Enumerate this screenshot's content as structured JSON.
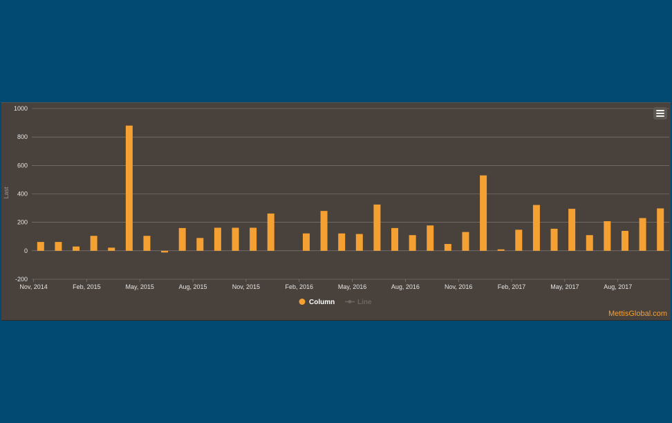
{
  "chart_data": {
    "type": "bar",
    "ylabel": "Last",
    "ylim": [
      -200,
      1000
    ],
    "yticks": [
      -200,
      0,
      200,
      400,
      600,
      800,
      1000
    ],
    "grid": true,
    "legend_position": "bottom-center",
    "x_tick_labels": [
      "Nov, 2014",
      "Feb, 2015",
      "May, 2015",
      "Aug, 2015",
      "Nov, 2015",
      "Feb, 2016",
      "May, 2016",
      "Aug, 2016",
      "Nov, 2016",
      "Feb, 2017",
      "May, 2017",
      "Aug, 2017"
    ],
    "categories": [
      "2014-11",
      "2014-12",
      "2015-01",
      "2015-02",
      "2015-03",
      "2015-04",
      "2015-05",
      "2015-06",
      "2015-07",
      "2015-08",
      "2015-09",
      "2015-10",
      "2015-11",
      "2015-12",
      "2016-01",
      "2016-02",
      "2016-03",
      "2016-04",
      "2016-05",
      "2016-06",
      "2016-07",
      "2016-08",
      "2016-09",
      "2016-10",
      "2016-11",
      "2016-12",
      "2017-01",
      "2017-02",
      "2017-03",
      "2017-04",
      "2017-05",
      "2017-06",
      "2017-07",
      "2017-08",
      "2017-09",
      "2017-10"
    ],
    "series": [
      {
        "name": "Column",
        "color": "#f5a033",
        "visible": true,
        "values": [
          62,
          62,
          30,
          105,
          22,
          880,
          105,
          -12,
          160,
          90,
          162,
          162,
          162,
          262,
          null,
          122,
          280,
          122,
          118,
          325,
          160,
          110,
          178,
          48,
          132,
          530,
          10,
          148,
          322,
          155,
          295,
          110,
          208,
          140,
          230,
          298
        ]
      },
      {
        "name": "Line",
        "color": "#6b6661",
        "visible": false,
        "values": []
      }
    ]
  },
  "watermark": "MettisGlobal.com",
  "colors": {
    "background": "#034a72",
    "panel": "#48413c",
    "gridline": "#8a847f",
    "bar": "#f5a033"
  }
}
